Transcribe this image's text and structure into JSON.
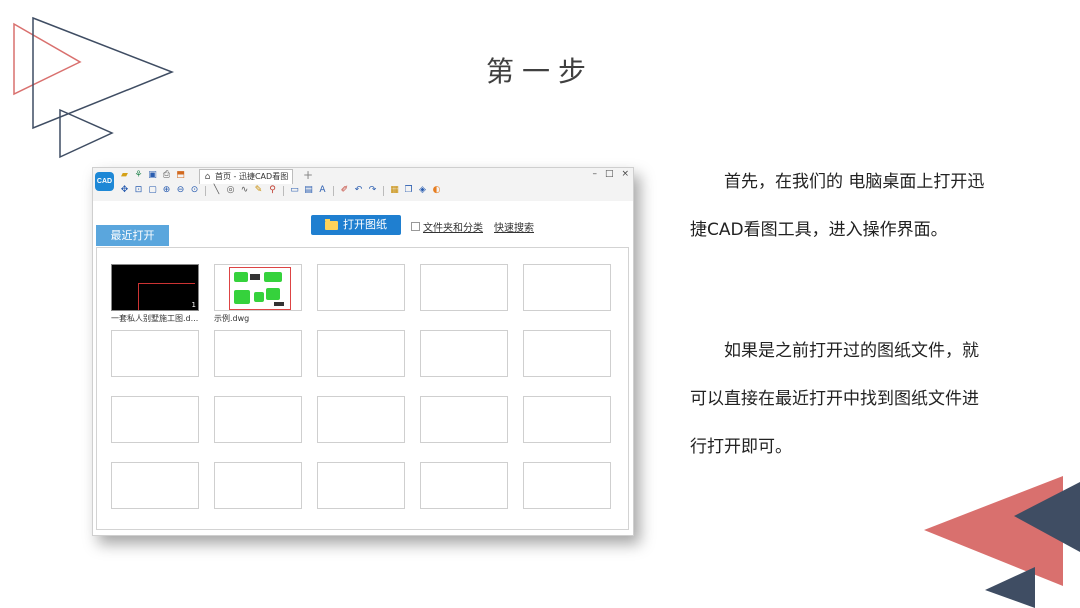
{
  "slide": {
    "title": "第一步",
    "paragraph1": "首先，在我们的 电脑桌面上打开迅捷CAD看图工具，进入操作界面。",
    "paragraph2": "如果是之前打开过的图纸文件，就可以直接在最近打开中找到图纸文件进行打开即可。"
  },
  "colors": {
    "salmon": "#d9706e",
    "navy": "#3f4d63",
    "accent_blue": "#1f7fd0",
    "tab_blue": "#5aa6dd"
  },
  "window": {
    "logo_text": "CAD",
    "tab_title": "首页 - 迅捷CAD看图",
    "new_tab": "+",
    "controls": {
      "minimize": "–",
      "maximize": "□",
      "close": "×"
    }
  },
  "toolbar_icons": [
    "open-icon",
    "tree-icon",
    "save-icon",
    "print-icon",
    "export-icon",
    "pan-icon",
    "zoom-window-icon",
    "zoom-extents-icon",
    "zoom-in-icon",
    "zoom-out-icon",
    "zoom-prev-icon",
    "line-icon",
    "circle-icon",
    "polyline-icon",
    "pen-icon",
    "measure-icon",
    "layer-icon",
    "layout-icon",
    "text-icon",
    "eraser-icon",
    "undo-icon",
    "redo-icon",
    "layer-manager-icon",
    "block-icon",
    "3d-icon",
    "color-icon"
  ],
  "content": {
    "open_button": "打开图纸",
    "folder_link": "文件夹和分类",
    "search_link": "快速搜索",
    "recent_tab": "最近打开",
    "recent_files": [
      {
        "name": "一套私人别墅施工图.d..."
      },
      {
        "name": "示例.dwg"
      }
    ],
    "thumbnail_mark": "1"
  }
}
